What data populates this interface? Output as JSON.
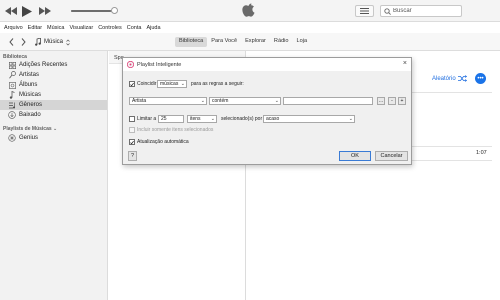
{
  "search": {
    "placeholder": "Buscar"
  },
  "menu": [
    "Arquivo",
    "Editar",
    "Música",
    "Visualizar",
    "Controles",
    "Conta",
    "Ajuda"
  ],
  "media_picker": {
    "label": "Música"
  },
  "tabs": [
    {
      "label": "Biblioteca",
      "active": true
    },
    {
      "label": "Para Você",
      "active": false
    },
    {
      "label": "Explorar",
      "active": false
    },
    {
      "label": "Rádio",
      "active": false
    },
    {
      "label": "Loja",
      "active": false
    }
  ],
  "sidebar": {
    "library_heading": "Biblioteca",
    "items": [
      {
        "label": "Adições Recentes",
        "icon": "grid-icon"
      },
      {
        "label": "Artistas",
        "icon": "microphone-icon"
      },
      {
        "label": "Álbuns",
        "icon": "album-icon"
      },
      {
        "label": "Músicas",
        "icon": "music-note-icon"
      },
      {
        "label": "Gêneros",
        "icon": "genres-icon",
        "selected": true
      },
      {
        "label": "Baixado",
        "icon": "download-icon"
      }
    ],
    "playlists_heading": "Playlists de Músicas",
    "playlists_arrow": "⌄",
    "playlists": [
      {
        "label": "Genius",
        "icon": "genius-icon"
      }
    ]
  },
  "column_browser": {
    "header": "Spo"
  },
  "main": {
    "shuffle_label": "Aleatório",
    "more_label": "•••",
    "time_value": "1:07"
  },
  "dialog": {
    "title": "Playlist Inteligente",
    "match": {
      "checkbox_label": "Coincidir",
      "checked": true,
      "scope_value": "músicas",
      "suffix": "para as regras a seguir:"
    },
    "rule": {
      "field_value": "Artista",
      "operator_value": "contém",
      "text_value": "",
      "btn_more": "…",
      "btn_remove": "-",
      "btn_add": "+"
    },
    "limit": {
      "checkbox_label": "Limitar a",
      "checked": false,
      "amount_value": "25",
      "unit_value": "itens",
      "selected_by_label": "selecionado(s) por",
      "method_value": "acaso"
    },
    "only_selected": {
      "label": "Incluir somente itens selecionados",
      "checked": false
    },
    "live_update": {
      "label": "Atualização automática",
      "checked": true
    },
    "help_label": "?",
    "ok_label": "OK",
    "cancel_label": "Cancelar"
  },
  "colors": {
    "accent": "#1a73e8",
    "selection": "#d5d5d5"
  }
}
